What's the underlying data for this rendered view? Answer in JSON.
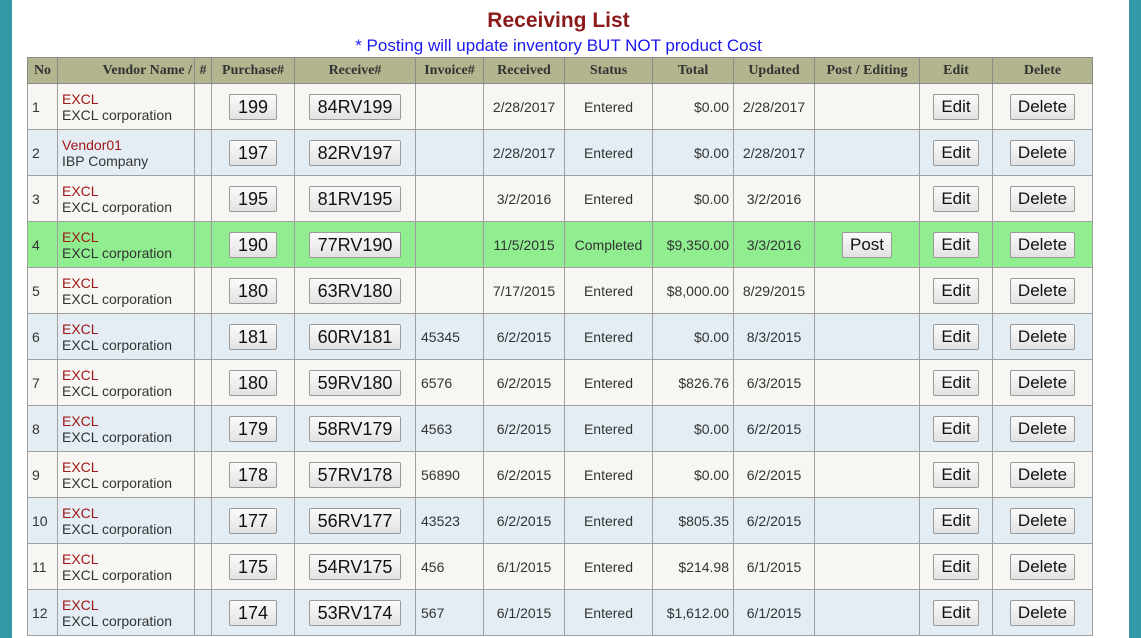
{
  "header": {
    "title": "Receiving List",
    "subtitle": "* Posting will update inventory BUT NOT product Cost"
  },
  "columns": [
    "No",
    "Vendor Name /",
    "#",
    "Purchase#",
    "Receive#",
    "Invoice#",
    "Received",
    "Status",
    "Total",
    "Updated",
    "Post / Editing",
    "Edit",
    "Delete"
  ],
  "buttons": {
    "edit": "Edit",
    "delete": "Delete",
    "post": "Post"
  },
  "rows": [
    {
      "no": "1",
      "vendor_code": "EXCL",
      "vendor_name": "EXCL corporation",
      "purchase": "199",
      "receive": "84RV199",
      "invoice": "",
      "received": "2/28/2017",
      "status": "Entered",
      "total": "$0.00",
      "updated": "2/28/2017",
      "post": false
    },
    {
      "no": "2",
      "vendor_code": "Vendor01",
      "vendor_name": "IBP Company",
      "purchase": "197",
      "receive": "82RV197",
      "invoice": "",
      "received": "2/28/2017",
      "status": "Entered",
      "total": "$0.00",
      "updated": "2/28/2017",
      "post": false
    },
    {
      "no": "3",
      "vendor_code": "EXCL",
      "vendor_name": "EXCL corporation",
      "purchase": "195",
      "receive": "81RV195",
      "invoice": "",
      "received": "3/2/2016",
      "status": "Entered",
      "total": "$0.00",
      "updated": "3/2/2016",
      "post": false
    },
    {
      "no": "4",
      "vendor_code": "EXCL",
      "vendor_name": "EXCL corporation",
      "purchase": "190",
      "receive": "77RV190",
      "invoice": "",
      "received": "11/5/2015",
      "status": "Completed",
      "total": "$9,350.00",
      "updated": "3/3/2016",
      "post": true
    },
    {
      "no": "5",
      "vendor_code": "EXCL",
      "vendor_name": "EXCL corporation",
      "purchase": "180",
      "receive": "63RV180",
      "invoice": "",
      "received": "7/17/2015",
      "status": "Entered",
      "total": "$8,000.00",
      "updated": "8/29/2015",
      "post": false
    },
    {
      "no": "6",
      "vendor_code": "EXCL",
      "vendor_name": "EXCL corporation",
      "purchase": "181",
      "receive": "60RV181",
      "invoice": "45345",
      "received": "6/2/2015",
      "status": "Entered",
      "total": "$0.00",
      "updated": "8/3/2015",
      "post": false
    },
    {
      "no": "7",
      "vendor_code": "EXCL",
      "vendor_name": "EXCL corporation",
      "purchase": "180",
      "receive": "59RV180",
      "invoice": "6576",
      "received": "6/2/2015",
      "status": "Entered",
      "total": "$826.76",
      "updated": "6/3/2015",
      "post": false
    },
    {
      "no": "8",
      "vendor_code": "EXCL",
      "vendor_name": "EXCL corporation",
      "purchase": "179",
      "receive": "58RV179",
      "invoice": "4563",
      "received": "6/2/2015",
      "status": "Entered",
      "total": "$0.00",
      "updated": "6/2/2015",
      "post": false
    },
    {
      "no": "9",
      "vendor_code": "EXCL",
      "vendor_name": "EXCL corporation",
      "purchase": "178",
      "receive": "57RV178",
      "invoice": "56890",
      "received": "6/2/2015",
      "status": "Entered",
      "total": "$0.00",
      "updated": "6/2/2015",
      "post": false
    },
    {
      "no": "10",
      "vendor_code": "EXCL",
      "vendor_name": "EXCL corporation",
      "purchase": "177",
      "receive": "56RV177",
      "invoice": "43523",
      "received": "6/2/2015",
      "status": "Entered",
      "total": "$805.35",
      "updated": "6/2/2015",
      "post": false
    },
    {
      "no": "11",
      "vendor_code": "EXCL",
      "vendor_name": "EXCL corporation",
      "purchase": "175",
      "receive": "54RV175",
      "invoice": "456",
      "received": "6/1/2015",
      "status": "Entered",
      "total": "$214.98",
      "updated": "6/1/2015",
      "post": false
    },
    {
      "no": "12",
      "vendor_code": "EXCL",
      "vendor_name": "EXCL corporation",
      "purchase": "174",
      "receive": "53RV174",
      "invoice": "567",
      "received": "6/1/2015",
      "status": "Entered",
      "total": "$1,612.00",
      "updated": "6/1/2015",
      "post": false
    }
  ],
  "colors": {
    "title": "#8b1a1a",
    "subtitle": "#1a1aee",
    "header_bg": "#b2b58e",
    "row_odd": "#f7f6f2",
    "row_even": "#e3edf3",
    "row_completed": "#90ee90",
    "frame": "#3399a6"
  }
}
